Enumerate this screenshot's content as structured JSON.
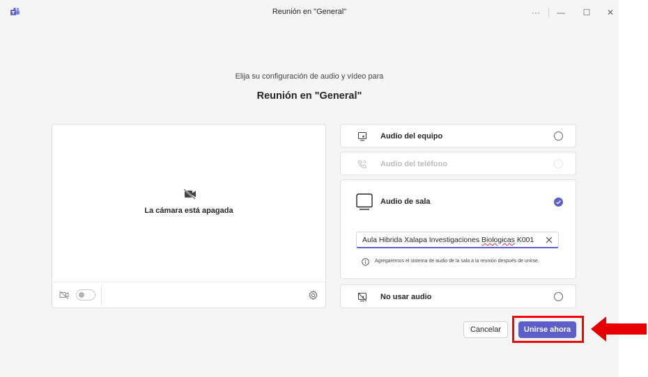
{
  "window": {
    "title": "Reunión en \"General\"",
    "controls": {
      "more": "···",
      "minimize": "—",
      "maximize": "☐",
      "close": "✕"
    }
  },
  "header": {
    "subtitle": "Elija su configuración de audio y vídeo para",
    "meeting_title": "Reunión en \"General\""
  },
  "preview": {
    "camera_status": "La cámara está apagada",
    "camera_toggle_on": false
  },
  "audio_options": [
    {
      "label": "Audio del equipo",
      "icon": "computer-audio-icon",
      "selected": false,
      "disabled": false
    },
    {
      "label": "Audio del teléfono",
      "icon": "phone-icon",
      "selected": false,
      "disabled": true
    },
    {
      "label": "Audio de sala",
      "icon": "room-audio-icon",
      "selected": true,
      "disabled": false
    },
    {
      "label": "No usar audio",
      "icon": "no-audio-icon",
      "selected": false,
      "disabled": false
    }
  ],
  "room": {
    "name_prefix": "Aula Hibrida Xalapa Investigaciones ",
    "name_misspelled": "Biologicas",
    "name_suffix": " K001",
    "info": "Agregaremos el sistema de audio de la sala a la reunión después de unirse."
  },
  "actions": {
    "cancel": "Cancelar",
    "join": "Unirse ahora"
  },
  "colors": {
    "accent": "#5b5fc7",
    "highlight": "#ff0000",
    "background": "#f5f5f5"
  }
}
